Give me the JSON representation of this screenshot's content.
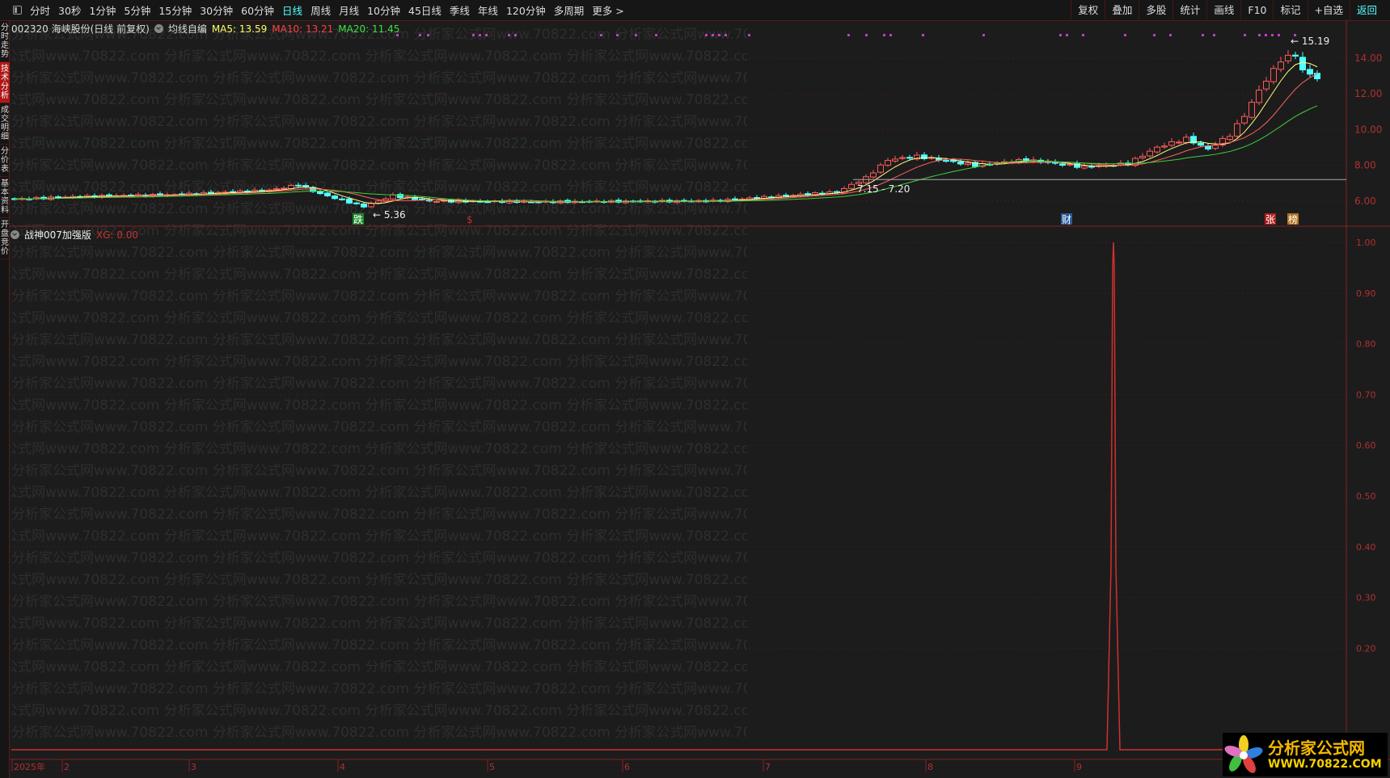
{
  "toolbar": {
    "periods": [
      "分时",
      "30秒",
      "1分钟",
      "5分钟",
      "15分钟",
      "30分钟",
      "60分钟",
      "日线",
      "周线",
      "月线",
      "10分钟",
      "45日线",
      "季线",
      "年线",
      "120分钟",
      "多周期",
      "更多 >"
    ],
    "active_period": "日线",
    "right": [
      "复权",
      "叠加",
      "多股",
      "统计",
      "画线",
      "F10",
      "标记",
      "+自选",
      "返回"
    ]
  },
  "sidebar": {
    "tabs": [
      "分时走势",
      "技术分析",
      "成交明细",
      "分价表",
      "基本资料",
      "开盘竞价"
    ],
    "active": "技术分析"
  },
  "price_panel": {
    "stock": "002320 海峡股份(日线 前复权)",
    "indicator": "均线自编",
    "ma5": "MA5: 13.59",
    "ma10": "MA10: 13.21",
    "ma20": "MA20: 11.45",
    "axis": [
      "14.00",
      "12.00",
      "10.00",
      "8.00",
      "6.00"
    ],
    "high_label": "15.19",
    "low_label": "5.36",
    "range_label": "7.15 - 7.20",
    "markers": [
      {
        "text": "跌",
        "color": "#1a8a2a"
      },
      {
        "text": "$",
        "color": "#c03030"
      },
      {
        "text": "财",
        "color": "#2a5a9a"
      },
      {
        "text": "张",
        "color": "#b02020"
      },
      {
        "text": "榜",
        "color": "#b07020"
      }
    ]
  },
  "indicator_panel": {
    "name": "战神007加强版",
    "value": "XG: 0.00",
    "axis": [
      "1.00",
      "0.90",
      "0.80",
      "0.70",
      "0.60",
      "0.50",
      "0.40",
      "0.30",
      "0.20"
    ]
  },
  "time_axis": [
    "2025年",
    "2",
    "3",
    "4",
    "5",
    "6",
    "7",
    "8",
    "9"
  ],
  "colors": {
    "up": "#ff5a5a",
    "down": "#54ffff",
    "ma5": "#ffff80",
    "ma10": "#ff6060",
    "ma20": "#40d040",
    "grid": "#6a1818"
  },
  "watermark": "分析家公式网www.70822.com",
  "logo": {
    "name": "分析家公式网",
    "url": "WWW.70822.COM"
  },
  "chart_data": {
    "type": "candlestick",
    "title": "002320 海峡股份 日线",
    "ylim": [
      5,
      15.5
    ],
    "close_keypoints": [
      [
        0,
        6.1
      ],
      [
        9,
        6.25
      ],
      [
        22,
        6.35
      ],
      [
        35,
        6.6
      ],
      [
        39,
        6.9
      ],
      [
        42,
        6.4
      ],
      [
        48,
        5.7
      ],
      [
        52,
        6.3
      ],
      [
        57,
        6.0
      ],
      [
        72,
        5.95
      ],
      [
        96,
        6.0
      ],
      [
        113,
        6.5
      ],
      [
        117,
        7.3
      ],
      [
        120,
        8.3
      ],
      [
        124,
        8.5
      ],
      [
        132,
        8.0
      ],
      [
        139,
        8.3
      ],
      [
        147,
        7.9
      ],
      [
        153,
        8.1
      ],
      [
        157,
        9.0
      ],
      [
        161,
        9.5
      ],
      [
        164,
        8.9
      ],
      [
        167,
        9.7
      ],
      [
        169,
        10.8
      ],
      [
        171,
        12.2
      ],
      [
        174,
        13.9
      ],
      [
        176,
        14.2
      ],
      [
        177,
        13.3
      ],
      [
        179,
        12.9
      ]
    ],
    "high": 15.19,
    "low": 5.36,
    "indicator_signal_index": 151,
    "indicator_ylim": [
      0,
      1
    ]
  }
}
